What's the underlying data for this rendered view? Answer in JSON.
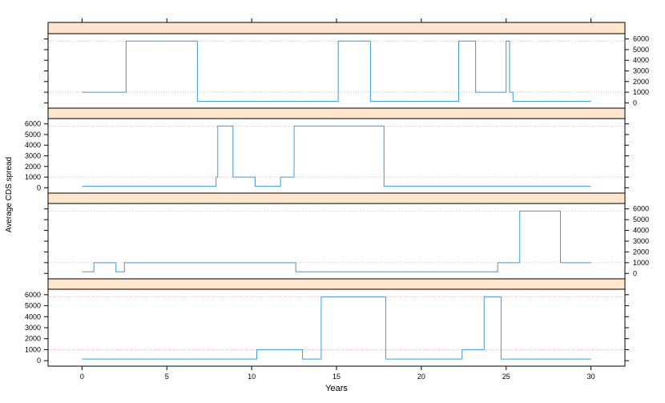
{
  "chart_data": {
    "type": "line",
    "title": "",
    "xlabel": "Years",
    "ylabel": "Average CDS spread",
    "xlim": [
      -2,
      32
    ],
    "ylim": [
      -500,
      6500
    ],
    "xticks": [
      0,
      5,
      10,
      15,
      20,
      25,
      30
    ],
    "yticks": [
      0,
      1000,
      2000,
      3000,
      4000,
      5000,
      6000
    ],
    "grid": "dotted reference lines at y = 1000 and y = 5800",
    "layout": "four stacked panels sharing the x axis, step lines",
    "colors": {
      "line": "#3a9ad9",
      "strip": "#ffe5cc",
      "ref": "#ff9999"
    },
    "panels": [
      {
        "points": [
          [
            0,
            1000
          ],
          [
            2.6,
            1000
          ],
          [
            2.6,
            5800
          ],
          [
            6.8,
            5800
          ],
          [
            6.8,
            150
          ],
          [
            15.1,
            150
          ],
          [
            15.1,
            5800
          ],
          [
            17,
            5800
          ],
          [
            17,
            150
          ],
          [
            22.2,
            150
          ],
          [
            22.2,
            5800
          ],
          [
            23.2,
            5800
          ],
          [
            23.2,
            1000
          ],
          [
            25,
            1000
          ],
          [
            25,
            5800
          ],
          [
            25.2,
            5800
          ],
          [
            25.2,
            1000
          ],
          [
            25.4,
            1000
          ],
          [
            25.4,
            150
          ],
          [
            30,
            150
          ]
        ]
      },
      {
        "points": [
          [
            0,
            150
          ],
          [
            7.9,
            150
          ],
          [
            7.9,
            1000
          ],
          [
            8,
            1000
          ],
          [
            8,
            5800
          ],
          [
            8.9,
            5800
          ],
          [
            8.9,
            1000
          ],
          [
            10.2,
            1000
          ],
          [
            10.2,
            150
          ],
          [
            11.7,
            150
          ],
          [
            11.7,
            1000
          ],
          [
            12.5,
            1000
          ],
          [
            12.5,
            5800
          ],
          [
            17.8,
            5800
          ],
          [
            17.8,
            150
          ],
          [
            30,
            150
          ]
        ]
      },
      {
        "points": [
          [
            0,
            150
          ],
          [
            0.7,
            150
          ],
          [
            0.7,
            1000
          ],
          [
            2,
            1000
          ],
          [
            2,
            150
          ],
          [
            2.5,
            150
          ],
          [
            2.5,
            1000
          ],
          [
            12.6,
            1000
          ],
          [
            12.6,
            150
          ],
          [
            24.5,
            150
          ],
          [
            24.5,
            1000
          ],
          [
            25.8,
            1000
          ],
          [
            25.8,
            5800
          ],
          [
            28.2,
            5800
          ],
          [
            28.2,
            1000
          ],
          [
            30,
            1000
          ]
        ]
      },
      {
        "points": [
          [
            0,
            150
          ],
          [
            10.3,
            150
          ],
          [
            10.3,
            1000
          ],
          [
            13,
            1000
          ],
          [
            13,
            150
          ],
          [
            14.1,
            150
          ],
          [
            14.1,
            5800
          ],
          [
            17.9,
            5800
          ],
          [
            17.9,
            150
          ],
          [
            22.4,
            150
          ],
          [
            22.4,
            1000
          ],
          [
            23.7,
            1000
          ],
          [
            23.7,
            5800
          ],
          [
            24.7,
            5800
          ],
          [
            24.7,
            150
          ],
          [
            30,
            150
          ]
        ]
      }
    ]
  }
}
